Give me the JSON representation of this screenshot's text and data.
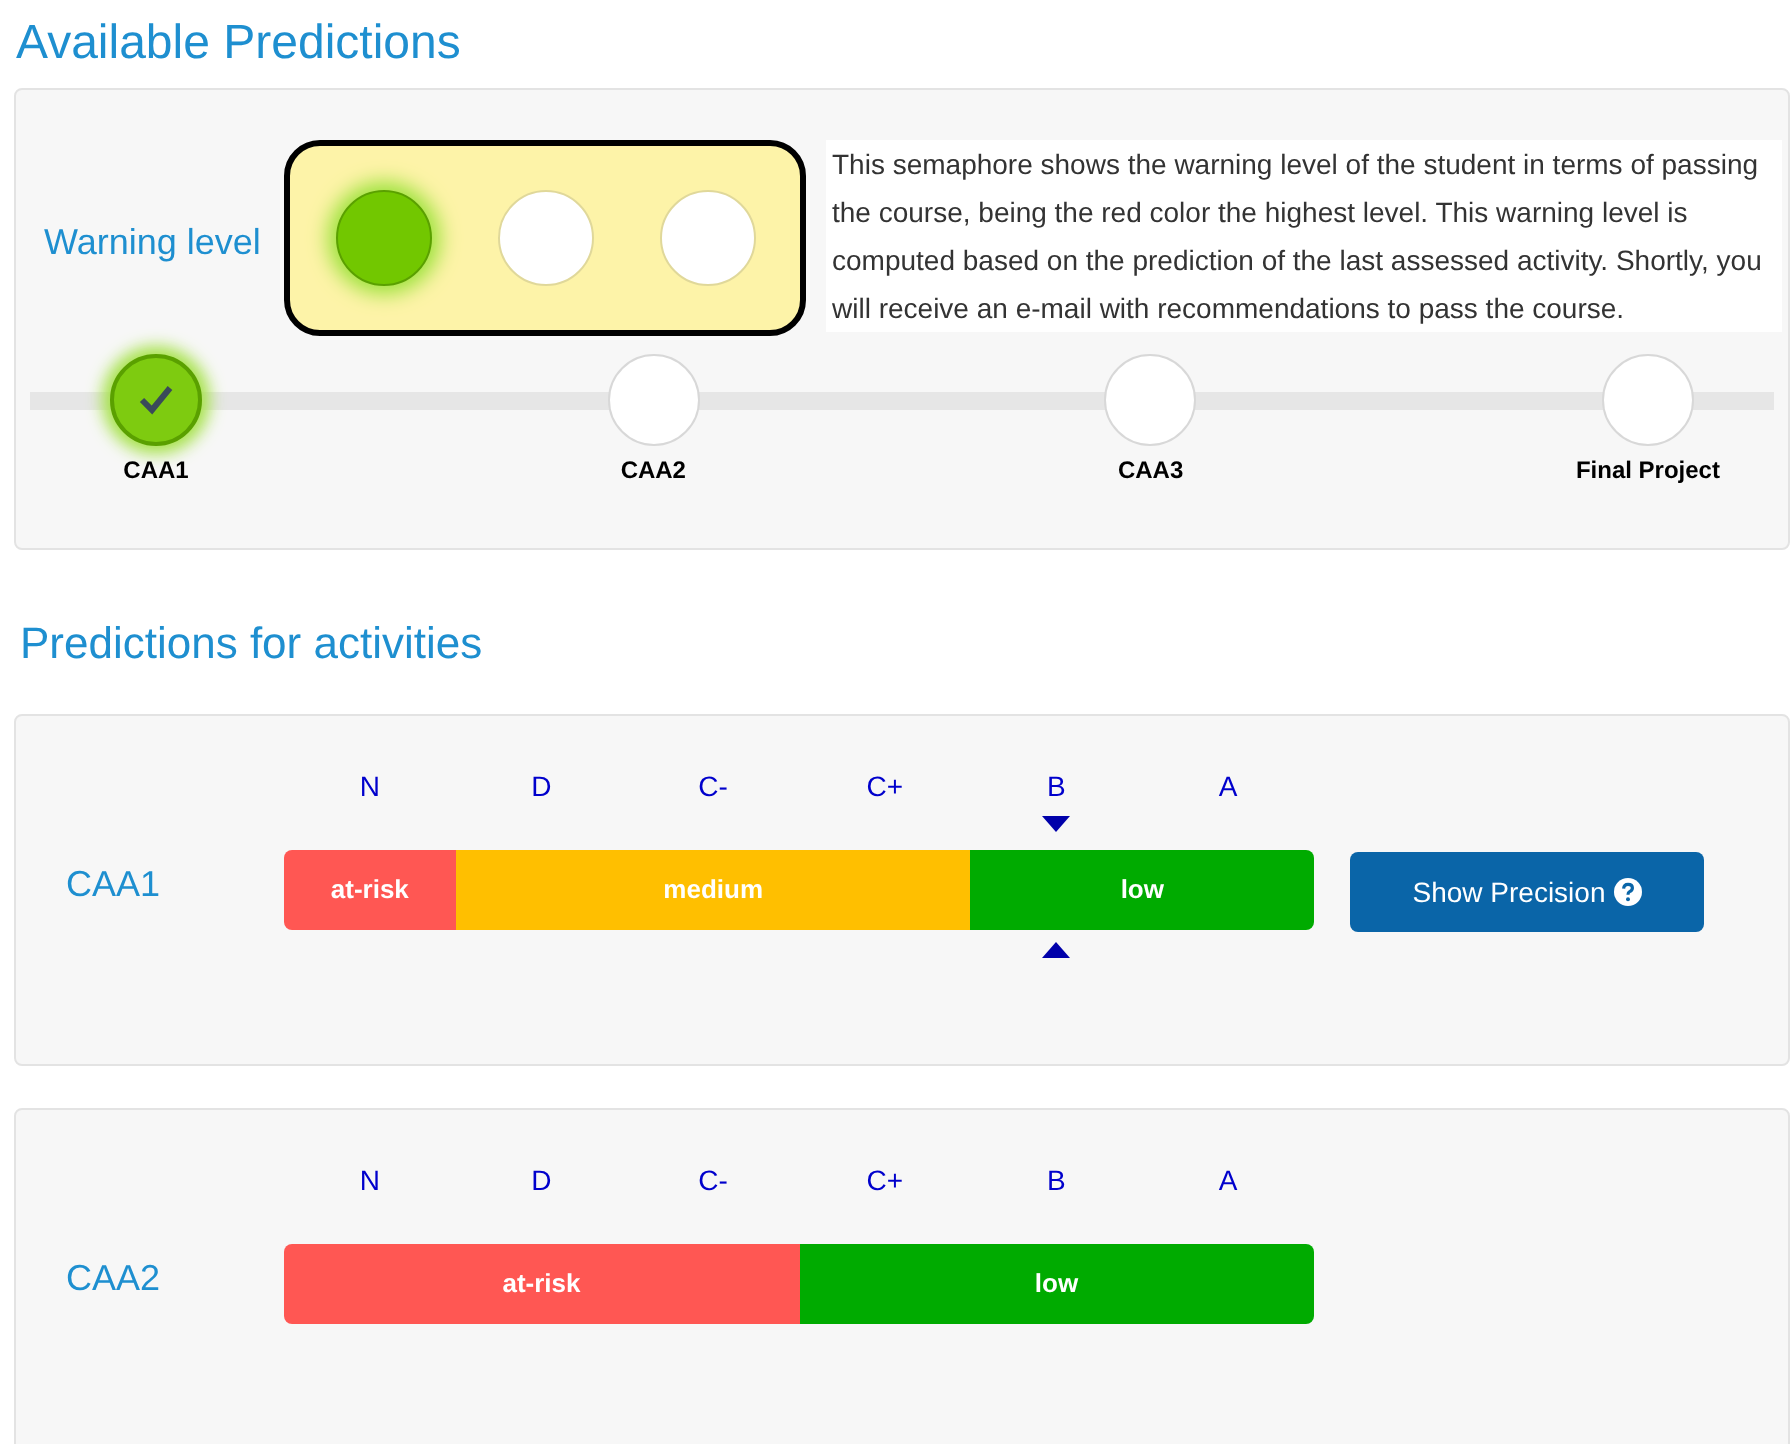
{
  "available": {
    "title": "Available Predictions",
    "warning_label": "Warning level",
    "lights": [
      {
        "on": true
      },
      {
        "on": false
      },
      {
        "on": false
      }
    ],
    "description": "This semaphore shows the warning level of the student in terms of passing the course, being the red color the highest level. This warning level is computed based on the prediction of the last assessed activity. Shortly, you will receive an e-mail with recommendations to pass the course.",
    "milestones": [
      {
        "label": "CAA1",
        "done": true
      },
      {
        "label": "CAA2",
        "done": false
      },
      {
        "label": "CAA3",
        "done": false
      },
      {
        "label": "Final Project",
        "done": false
      }
    ]
  },
  "activities": {
    "title": "Predictions for activities",
    "cards": [
      {
        "name": "CAA1",
        "grades": [
          {
            "label": "N",
            "selected": false,
            "kind": "atrisk"
          },
          {
            "label": "D",
            "selected": false,
            "kind": "medium"
          },
          {
            "label": "C-",
            "selected": false,
            "kind": "medium"
          },
          {
            "label": "C+",
            "selected": false,
            "kind": "medium"
          },
          {
            "label": "B",
            "selected": true,
            "kind": "low"
          },
          {
            "label": "A",
            "selected": false,
            "kind": "low"
          }
        ],
        "segments": [
          {
            "label": "at-risk"
          },
          {
            "label": "medium"
          },
          {
            "label": "low"
          }
        ],
        "button": "Show Precision"
      },
      {
        "name": "CAA2",
        "grades": [
          {
            "label": "N",
            "selected": false,
            "kind": "atrisk"
          },
          {
            "label": "D",
            "selected": false,
            "kind": "atrisk"
          },
          {
            "label": "C-",
            "selected": false,
            "kind": "atrisk"
          },
          {
            "label": "C+",
            "selected": false,
            "kind": "low"
          },
          {
            "label": "B",
            "selected": false,
            "kind": "low"
          },
          {
            "label": "A",
            "selected": false,
            "kind": "low"
          }
        ],
        "segments": [
          {
            "label": "at-risk"
          },
          {
            "label": "low"
          }
        ]
      }
    ]
  }
}
